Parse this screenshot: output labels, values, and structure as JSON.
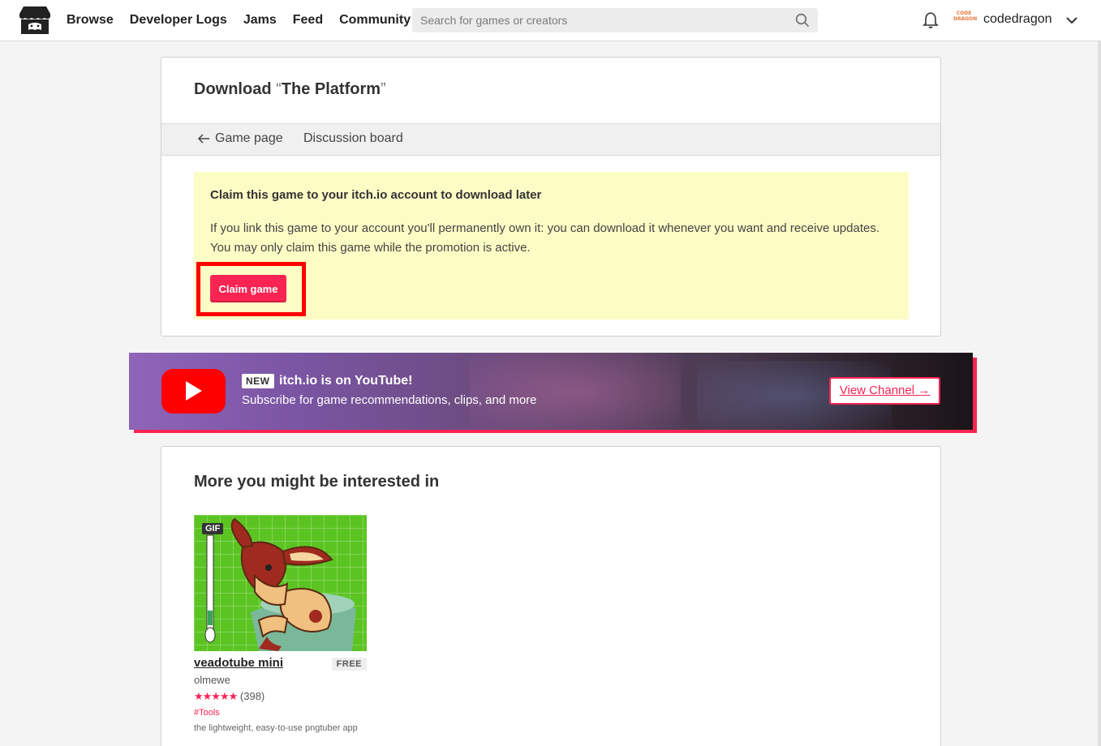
{
  "header": {
    "nav": [
      "Browse",
      "Developer Logs",
      "Jams",
      "Feed",
      "Community"
    ],
    "search_placeholder": "Search for games or creators",
    "avatar_text": "CODE DRAGON",
    "username": "codedragon"
  },
  "download_card": {
    "title_prefix": "Download",
    "open_quote": "“",
    "game_title": "The Platform",
    "close_quote": "”",
    "tabs": {
      "game_page": "Game page",
      "discussion": "Discussion board"
    },
    "claim": {
      "heading": "Claim this game to your itch.io account to download later",
      "body": "If you link this game to your account you'll permanently own it: you can download it whenever you want and receive updates. You may only claim this game while the promotion is active.",
      "button": "Claim game"
    }
  },
  "youtube_banner": {
    "badge": "NEW",
    "title": "itch.io is on YouTube!",
    "subtitle": "Subscribe for game recommendations, clips, and more",
    "button": "View Channel →"
  },
  "recommendations": {
    "title": "More you might be interested in",
    "games": [
      {
        "badge": "GIF",
        "name": "veadotube mini",
        "price": "FREE",
        "author": "olmewe",
        "stars": "★★★★★",
        "rating_count": "(398)",
        "tag": "#Tools",
        "description": "the lightweight, easy-to-use pngtuber app"
      }
    ]
  },
  "colors": {
    "accent": "#fa2452",
    "claim_bg": "#fcfcc5",
    "highlight": "#ff0000",
    "youtube_red": "#ff0000"
  }
}
